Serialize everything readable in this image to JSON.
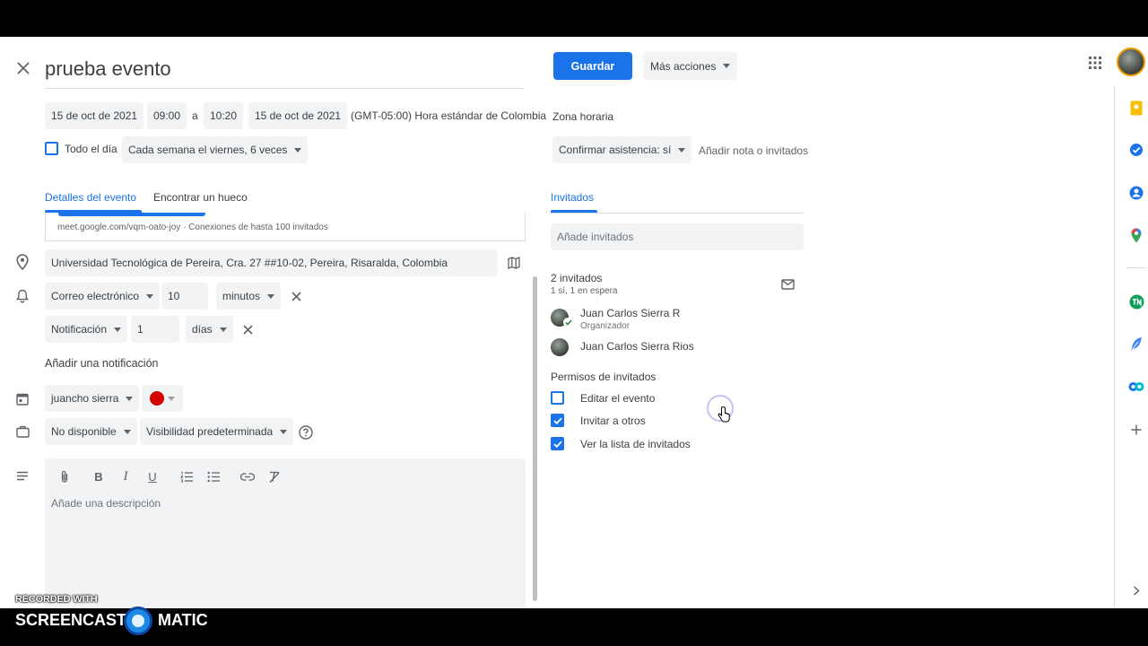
{
  "header": {
    "title": "prueba evento",
    "save_label": "Guardar",
    "more_actions_label": "Más acciones"
  },
  "datetime": {
    "start_date": "15 de oct de 2021",
    "start_time": "09:00",
    "to_label": "a",
    "end_time": "10:20",
    "end_date": "15 de oct de 2021",
    "timezone": "(GMT-05:00) Hora estándar de Colombia",
    "timezone_link": "Zona horaria",
    "all_day_label": "Todo el día",
    "recurrence": "Cada semana el viernes, 6 veces"
  },
  "rsvp": {
    "value": "Confirmar asistencia: sí",
    "note_label": "Añadir nota o invitados"
  },
  "tabs": {
    "details": "Detalles del evento",
    "find_time": "Encontrar un hueco",
    "guests": "Invitados"
  },
  "details": {
    "meet_info": "meet.google.com/vqm-oato-joy · Conexiones de hasta 100 invitados",
    "location": "Universidad Tecnológica de Pereira, Cra. 27 ##10-02, Pereira, Risaralda, Colombia",
    "notifications": [
      {
        "type": "Correo electrónico",
        "amount": "10",
        "unit": "minutos"
      },
      {
        "type": "Notificación",
        "amount": "1",
        "unit": "días"
      }
    ],
    "add_notification": "Añadir una notificación",
    "calendar": "juancho sierra",
    "calendar_color": "#d50000",
    "availability": "No disponible",
    "visibility": "Visibilidad predeterminada",
    "description_placeholder": "Añade una descripción"
  },
  "guests": {
    "input_placeholder": "Añade invitados",
    "count": "2 invitados",
    "summary": "1 sí, 1 en espera",
    "list": [
      {
        "name": "Juan Carlos Sierra R",
        "role": "Organizador"
      },
      {
        "name": "Juan Carlos Sierra Rios",
        "role": ""
      }
    ],
    "permissions_title": "Permisos de invitados",
    "permissions": [
      {
        "label": "Editar el evento",
        "checked": false
      },
      {
        "label": "Invitar a otros",
        "checked": true
      },
      {
        "label": "Ver la lista de invitados",
        "checked": true
      }
    ]
  },
  "watermark": {
    "recorded": "RECORDED WITH",
    "brand_left": "SCREENCAST",
    "brand_right": "MATIC"
  },
  "colors": {
    "accent": "#1a73e8",
    "chip_bg": "#f1f3f4"
  }
}
